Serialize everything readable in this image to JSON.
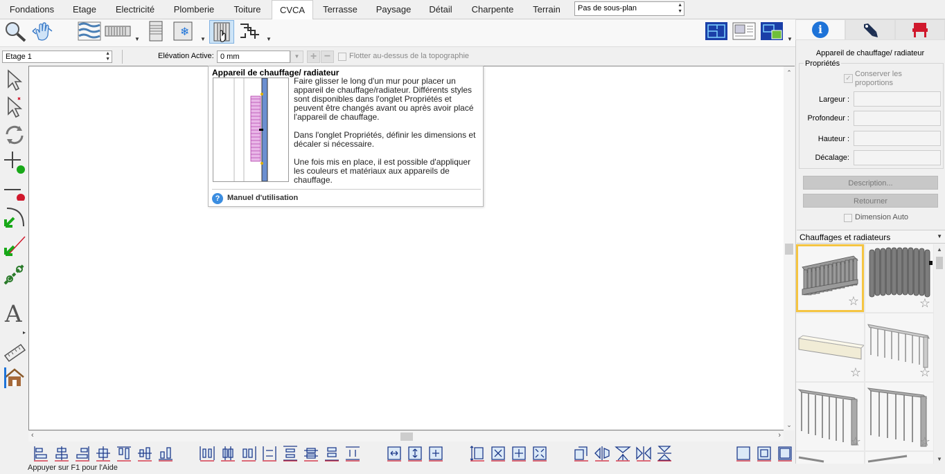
{
  "tabs": [
    "Fondations",
    "Etage",
    "Electricité",
    "Plomberie",
    "Toiture",
    "CVCA",
    "Terrasse",
    "Paysage",
    "Détail",
    "Charpente",
    "Terrain"
  ],
  "active_tab": "CVCA",
  "subplan_select": "Pas de sous-plan",
  "floor_select": "Etage 1",
  "elevation_label": "Elévation Active:",
  "elevation_value": "0 mm",
  "float_label": "Flotter au-dessus de la topographie",
  "tooltip": {
    "title": "Appareil de chauffage/ radiateur",
    "p1": "Faire glisser le long d'un mur pour placer un appareil de chauffage/radiateur. Différents styles sont disponibles dans l'onglet Propriétés et peuvent être changés avant ou après avoir placé l'appareil de chauffage.",
    "p2": "Dans l'onglet Propriétés, définir les dimensions et décaler si nécessaire.",
    "p3": "Une fois mis en place, il est possible d'appliquer les couleurs et matériaux aux appareils de chauffage.",
    "manual": "Manuel d'utilisation"
  },
  "panel": {
    "title": "Appareil de chauffage/ radiateur",
    "group": "Propriétés",
    "keep_ratio": "Conserver les proportions",
    "width_label": "Largeur :",
    "depth_label": "Profondeur :",
    "height_label": "Hauteur :",
    "offset_label": "Décalage:",
    "description_btn": "Description...",
    "back_btn": "Retourner",
    "auto_dim": "Dimension Auto"
  },
  "library": {
    "category": "Chauffages et radiateurs"
  },
  "status": "Appuyer sur F1 pour l'Aide",
  "colors": {
    "accent": "#1e73d8",
    "selected": "#f5c542",
    "red": "#d0182c",
    "green": "#18a818"
  }
}
